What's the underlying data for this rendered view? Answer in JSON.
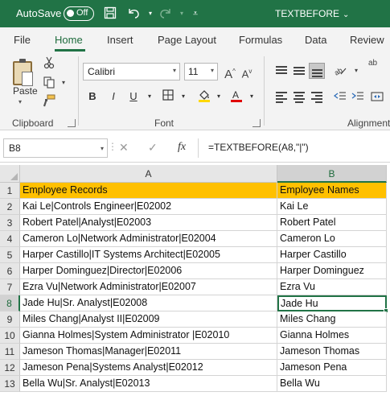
{
  "titlebar": {
    "autosave_label": "AutoSave",
    "autosave_state": "Off",
    "doc_title": "TEXTBEFORE",
    "icons": [
      "save-icon",
      "undo-icon",
      "redo-icon",
      "customize-icon"
    ]
  },
  "ribbon_tabs": [
    "File",
    "Home",
    "Insert",
    "Page Layout",
    "Formulas",
    "Data",
    "Review"
  ],
  "active_tab": "Home",
  "ribbon": {
    "paste_label": "Paste",
    "font_name": "Calibri",
    "font_size": "11",
    "bold": "B",
    "italic": "I",
    "underline": "U",
    "increase_font": "A",
    "decrease_font": "A",
    "groups": {
      "clipboard": "Clipboard",
      "font": "Font",
      "alignment": "Alignment"
    },
    "wrap_label": "ab"
  },
  "formula_bar": {
    "name_box": "B8",
    "formula": "=TEXTBEFORE(A8,\"|\")"
  },
  "grid": {
    "columns": [
      "A",
      "B"
    ],
    "selected_column": "B",
    "selected_row": "8",
    "rows": [
      {
        "num": "1",
        "a": "Employee Records",
        "b": "Employee Names"
      },
      {
        "num": "2",
        "a": "Kai Le|Controls Engineer|E02002",
        "b": "Kai Le"
      },
      {
        "num": "3",
        "a": "Robert Patel|Analyst|E02003",
        "b": "Robert Patel"
      },
      {
        "num": "4",
        "a": "Cameron Lo|Network Administrator|E02004",
        "b": "Cameron Lo"
      },
      {
        "num": "5",
        "a": "Harper Castillo|IT Systems Architect|E02005",
        "b": "Harper Castillo"
      },
      {
        "num": "6",
        "a": "Harper Dominguez|Director|E02006",
        "b": "Harper Dominguez"
      },
      {
        "num": "7",
        "a": "Ezra Vu|Network Administrator|E02007",
        "b": "Ezra Vu"
      },
      {
        "num": "8",
        "a": "Jade Hu|Sr. Analyst|E02008",
        "b": "Jade Hu"
      },
      {
        "num": "9",
        "a": "Miles Chang|Analyst II|E02009",
        "b": "Miles Chang"
      },
      {
        "num": "10",
        "a": "Gianna Holmes|System Administrator |E02010",
        "b": "Gianna Holmes"
      },
      {
        "num": "11",
        "a": "Jameson Thomas|Manager|E02011",
        "b": "Jameson Thomas"
      },
      {
        "num": "12",
        "a": "Jameson Pena|Systems Analyst|E02012",
        "b": "Jameson Pena"
      },
      {
        "num": "13",
        "a": "Bella Wu|Sr. Analyst|E02013",
        "b": "Bella Wu"
      }
    ]
  },
  "colors": {
    "excel_green": "#217346",
    "header_fill": "#ffc000",
    "highlight_yellow": "#ffd800",
    "font_red": "#e00000"
  }
}
